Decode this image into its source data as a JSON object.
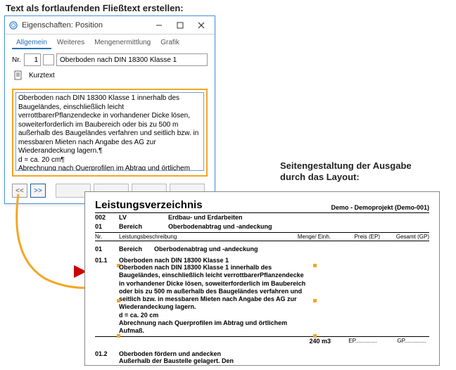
{
  "captions": {
    "top": "Text als fortlaufenden Fließtext erstellen:",
    "right1": "Seitengestaltung der Ausgabe",
    "right2": "durch das Layout:"
  },
  "dialog": {
    "title": "Eigenschaften: Position",
    "tabs": {
      "allgemein": "Allgemein",
      "weiteres": "Weiteres",
      "mengen": "Mengenermittlung",
      "grafik": "Grafik"
    },
    "labels": {
      "nr": "Nr.",
      "kurztext": "Kurztext"
    },
    "fields": {
      "nr_value": "1",
      "kurztext_value": "Oberboden nach DIN 18300 Klasse 1"
    },
    "longtext": "Oberboden nach DIN 18300 Klasse 1 innerhalb des Baugeländes, einschließlich leicht verrottbarerPflanzendecke in vorhandener Dicke lösen, soweiterforderlich im Baubereich oder bis zu 500 m außerhalb des Baugeländes verfahren und seitlich bzw. in messbaren Mieten nach Angabe des AG zur Wiederandeckung lagern.¶\nd = ca. 20 cm¶\nAbrechnung nach Querprofilen im Abtrag und örtlichem Aufmaß.",
    "nav": {
      "prev": "<<",
      "next": ">>"
    }
  },
  "output": {
    "title": "Leistungsverzeichnis",
    "project": "Demo - Demoprojekt (Demo-001)",
    "header": {
      "num1": "002",
      "lbl1": "LV",
      "val1": "Erdbau- und Erdarbeiten",
      "num2": "01",
      "lbl2": "Bereich",
      "val2": "Oberbodenabtrag und -andeckung"
    },
    "columns": {
      "nr": "Nr.",
      "desc": "Leistungsbeschreibung",
      "qty": "Menge/ Einh.",
      "ep": "Preis (EP)",
      "gp": "Gesamt (GP)"
    },
    "section": {
      "nr": "01",
      "lbl": "Bereich",
      "title": "Oberbodenabtrag und -andeckung"
    },
    "pos1": {
      "nr": "01.1",
      "title": "Oberboden nach DIN 18300 Klasse 1",
      "long": "Oberboden nach DIN 18300 Klasse 1 innerhalb des Baugeländes, einschließlich leicht verrottbarerPflanzendecke in vorhandener Dicke lösen, soweiterforderlich im Baubereich oder bis zu 500 m außerhalb des Baugeländes verfahren und seitlich bzw. in messbaren Mieten nach Angabe des AG zur Wiederandeckung lagern.\nd = ca. 20 cm\nAbrechnung nach Querprofilen im Abtrag und örtlichem Aufmaß.",
      "qty": "240 m3",
      "ep_label": "EP",
      "gp_label": "GP"
    },
    "pos2": {
      "nr": "01.2",
      "title": "Oberboden fördern und andecken",
      "long_first": "Außerhalb der Baustelle gelagert. Den"
    }
  }
}
